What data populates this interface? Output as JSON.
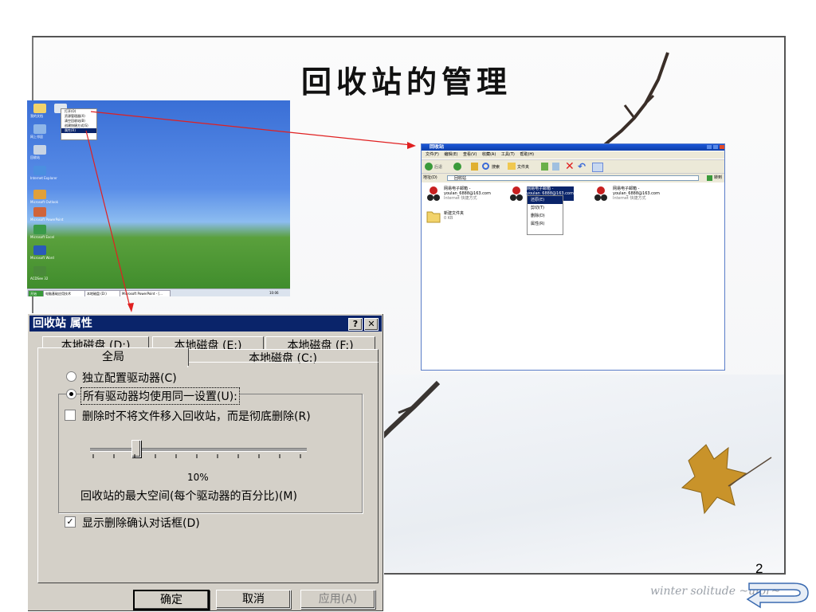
{
  "slide": {
    "title": "回收站的管理",
    "page_number": "2",
    "watermark": "winter solitude ~uior~"
  },
  "desktop": {
    "icon_labels": [
      "我的文档",
      "我的电脑",
      "网上邻居",
      "回收站",
      "Internet Explorer",
      "Microsoft Outlook",
      "Microsoft PowerPoint",
      "Microsoft Excel",
      "Microsoft Word",
      "ACDSee 32"
    ],
    "context_menu": [
      "打开(O)",
      "资源管理器(X)",
      "清空回收站(B)",
      "创建快捷方式(S)",
      "属性(R)"
    ],
    "taskbar": {
      "start": "开始",
      "tasks": [
        "电脑基础应用技术",
        "本地磁盘 (D:)",
        "Microsoft PowerPoint - [..."
      ],
      "clock": "10:06"
    }
  },
  "recycle_window": {
    "title": "回收站",
    "menu": [
      "文件(F)",
      "编辑(E)",
      "查看(V)",
      "收藏(A)",
      "工具(T)",
      "帮助(H)"
    ],
    "toolbar": {
      "back": "后退",
      "search": "搜索",
      "folders": "文件夹"
    },
    "address_label": "地址(D)",
    "address_value": "回收站",
    "go": "转到",
    "items": [
      {
        "name": "网易电子邮箱 - youlan_6888@163.com",
        "line1": "网易电子邮箱 -",
        "line2": "youlan_6888@163.com",
        "line3": "Internet 快捷方式"
      },
      {
        "name": "网易电子邮箱 - youlan_6888@163.com",
        "line1": "网易电子邮箱 -",
        "line2": "youlan_6888@163.com",
        "line3": "Internet 快捷方式"
      },
      {
        "name": "网易电子邮箱 - youlan_6888@163.com",
        "line1": "网易电子邮箱 -",
        "line2": "youlan_6888@163.com",
        "line3": "Internet 快捷方式"
      },
      {
        "name": "新建文件夹",
        "line1": "新建文件夹",
        "line2": "0 KB",
        "line3": ""
      }
    ],
    "context_menu": [
      "还原(E)",
      "剪切(T)",
      "删除(D)",
      "属性(R)"
    ]
  },
  "dialog": {
    "title": "回收站 属性",
    "help_btn": "?",
    "close_btn": "✕",
    "tabs_back": [
      "本地磁盘 (D:)",
      "本地磁盘 (E:)",
      "本地磁盘 (F:)"
    ],
    "tabs_front": [
      "全局",
      "本地磁盘 (C:)"
    ],
    "radio_independent": "独立配置驱动器(C)",
    "radio_same": "所有驱动器均使用同一设置(U):",
    "check_delete": "删除时不将文件移入回收站，而是彻底删除(R)",
    "slider_value": "10%",
    "slider_percent": 10,
    "slider_label": "回收站的最大空间(每个驱动器的百分比)(M)",
    "check_confirm": "显示删除确认对话框(D)",
    "ok": "确定",
    "cancel": "取消",
    "apply": "应用(A)"
  }
}
